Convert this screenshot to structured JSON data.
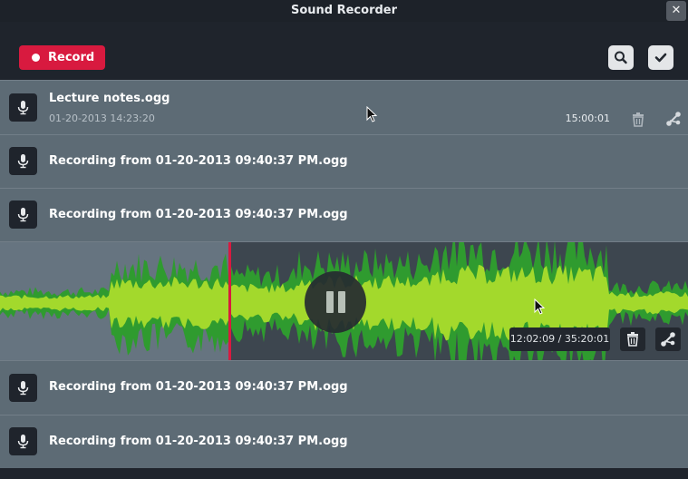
{
  "window": {
    "title": "Sound Recorder",
    "close_glyph": "✕"
  },
  "toolbar": {
    "record_label": "Record",
    "search_icon": "search-icon",
    "done_icon": "checkmark-icon"
  },
  "recordings": [
    {
      "title": "Lecture notes.ogg",
      "date": "01-20-2013 14:23:20",
      "duration": "15:00:01",
      "expanded": false
    },
    {
      "title": "Recording from 01-20-2013 09:40:37 PM.ogg"
    },
    {
      "title": "Recording from 01-20-2013 09:40:37 PM.ogg"
    },
    {
      "title": "Recording from 01-20-2013 09:40:37 PM.ogg"
    },
    {
      "title": "Recording from 01-20-2013 09:40:37 PM.ogg"
    }
  ],
  "player": {
    "time_text": "12:02:09 / 35:20:01",
    "progress_fraction": 0.34,
    "state": "playing"
  },
  "colors": {
    "accent": "#d81a3f",
    "wave_light": "#a3d92c",
    "wave_dark": "#2f9b2f",
    "row_bg": "#5d6b75",
    "header_bg": "#1f242c"
  }
}
